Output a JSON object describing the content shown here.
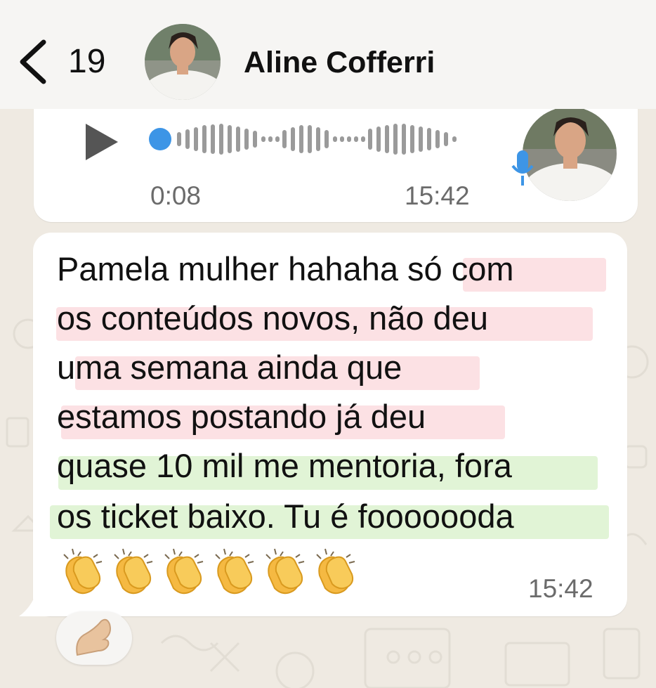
{
  "header": {
    "unread_count": "19",
    "contact_name": "Aline Cofferri"
  },
  "voice_message": {
    "duration": "0:08",
    "time": "15:42"
  },
  "text_message": {
    "lines": [
      "Pamela mulher hahaha só com",
      "os conteúdos novos, não deu",
      "uma semana ainda que",
      "estamos postando já deu",
      "quase 10 mil me mentoria, fora",
      "os ticket baixo. Tu é fooooooda"
    ],
    "emojis": [
      "👏",
      "👏",
      "👏",
      "👏",
      "👏",
      "👏"
    ],
    "time": "15:42"
  },
  "reaction": {
    "emoji": "🤌",
    "skin_tone": "light"
  },
  "colors": {
    "background": "#efeae2",
    "header": "#f6f5f3",
    "bubble": "#ffffff",
    "accent_blue": "#3d95e6",
    "highlight_pink": "#fac8cd",
    "highlight_green": "#c8ebb4"
  },
  "icons": [
    "back-chevron-icon",
    "play-icon",
    "waveform-icon",
    "microphone-icon"
  ]
}
